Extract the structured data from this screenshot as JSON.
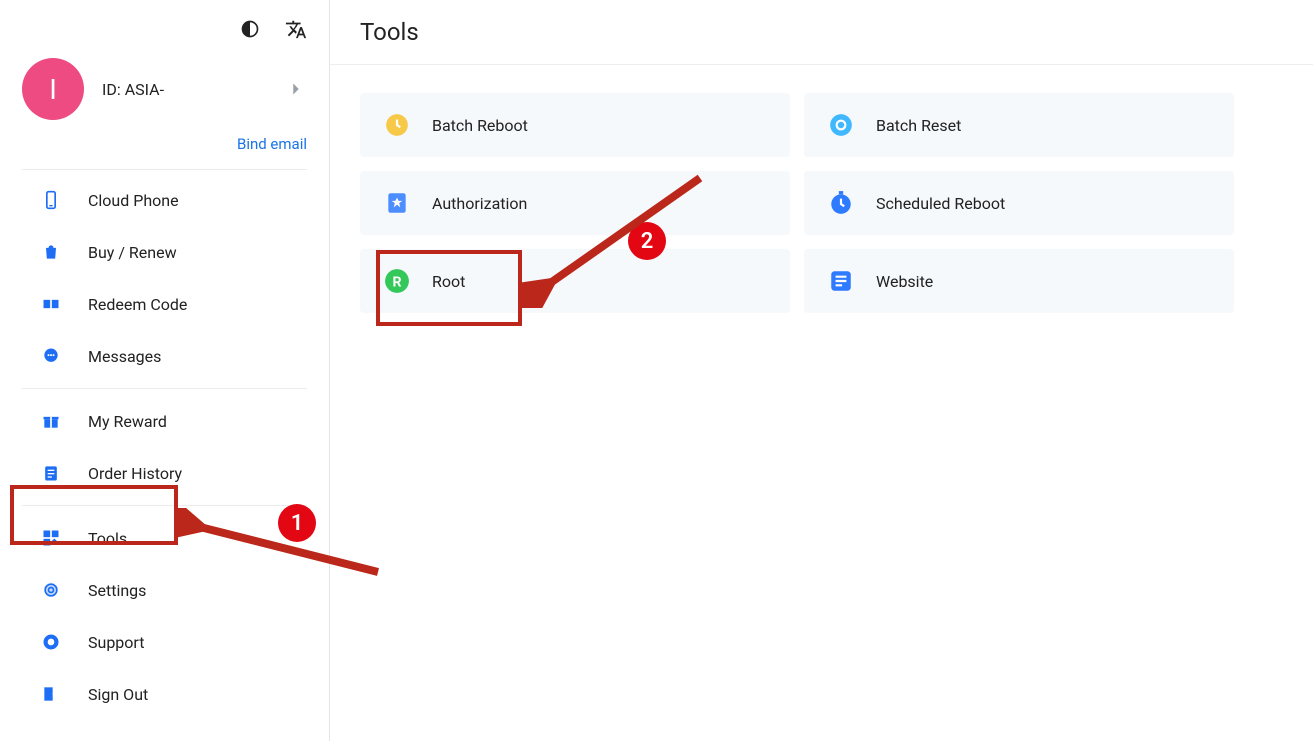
{
  "header": {
    "theme_icon": "contrast",
    "lang_icon": "translate"
  },
  "profile": {
    "avatar_letter": "I",
    "id_text": "ID: ASIA-",
    "bind_email": "Bind email"
  },
  "sidebar": {
    "items": [
      {
        "label": "Cloud Phone",
        "icon": "phone"
      },
      {
        "label": "Buy / Renew",
        "icon": "bag"
      },
      {
        "label": "Redeem Code",
        "icon": "ticket"
      },
      {
        "label": "Messages",
        "icon": "chat"
      },
      {
        "label": "My Reward",
        "icon": "gift"
      },
      {
        "label": "Order History",
        "icon": "clipboard"
      },
      {
        "label": "Tools",
        "icon": "grid"
      },
      {
        "label": "Settings",
        "icon": "gear"
      },
      {
        "label": "Support",
        "icon": "support"
      },
      {
        "label": "Sign Out",
        "icon": "signout"
      }
    ]
  },
  "main": {
    "title": "Tools",
    "tools": [
      {
        "label": "Batch Reboot",
        "icon": "clock-yellow"
      },
      {
        "label": "Batch Reset",
        "icon": "ring-blue"
      },
      {
        "label": "Authorization",
        "icon": "badge-blue"
      },
      {
        "label": "Scheduled Reboot",
        "icon": "stopwatch-blue"
      },
      {
        "label": "Root",
        "icon": "root-green"
      },
      {
        "label": "Website",
        "icon": "web-blue"
      }
    ]
  },
  "annotations": {
    "n1": "1",
    "n2": "2"
  }
}
